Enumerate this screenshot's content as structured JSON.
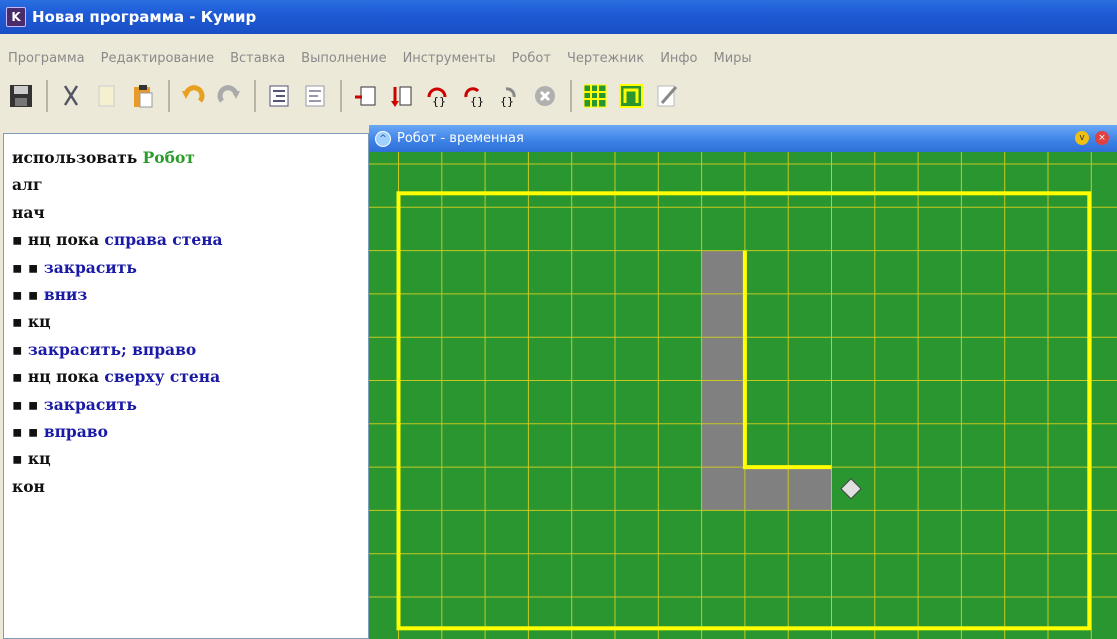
{
  "window": {
    "title": "Новая программа - Кумир",
    "app_icon": "K"
  },
  "menu": [
    "Программа",
    "Редактирование",
    "Вставка",
    "Выполнение",
    "Инструменты",
    "Робот",
    "Чертежник",
    "Инфо",
    "Миры"
  ],
  "toolbar": {
    "icons": [
      "save-icon",
      "cut-icon",
      "copy-icon",
      "paste-icon",
      "undo-icon",
      "redo-icon",
      "indent-icon",
      "unindent-icon",
      "run-icon",
      "step-icon",
      "step-into-icon",
      "step-over-icon",
      "step-out-icon",
      "stop-icon",
      "robot-field-icon",
      "robot-pult-icon",
      "draw-icon"
    ]
  },
  "editor": {
    "lines": [
      [
        {
          "t": "использовать ",
          "c": "plain"
        },
        {
          "t": "Робот",
          "c": "green"
        }
      ],
      [
        {
          "t": "алг",
          "c": "plain"
        }
      ],
      [
        {
          "t": "нач",
          "c": "plain"
        }
      ],
      [
        {
          "t": "▪ нц пока ",
          "c": "plain"
        },
        {
          "t": "справа стена",
          "c": "blue"
        }
      ],
      [
        {
          "t": "▪ ▪ ",
          "c": "plain"
        },
        {
          "t": "закрасить",
          "c": "blue"
        }
      ],
      [
        {
          "t": "▪ ▪ ",
          "c": "plain"
        },
        {
          "t": "вниз",
          "c": "blue"
        }
      ],
      [
        {
          "t": "▪ кц",
          "c": "plain"
        }
      ],
      [
        {
          "t": "▪ ",
          "c": "plain"
        },
        {
          "t": "закрасить; вправо",
          "c": "blue"
        }
      ],
      [
        {
          "t": "▪ нц пока ",
          "c": "plain"
        },
        {
          "t": "сверху стена",
          "c": "blue"
        }
      ],
      [
        {
          "t": "▪ ▪ ",
          "c": "plain"
        },
        {
          "t": "закрасить",
          "c": "blue"
        }
      ],
      [
        {
          "t": "▪ ▪ ",
          "c": "plain"
        },
        {
          "t": "вправо",
          "c": "blue"
        }
      ],
      [
        {
          "t": "▪ кц",
          "c": "plain"
        }
      ],
      [
        {
          "t": "кон",
          "c": "plain"
        }
      ]
    ]
  },
  "robot_window": {
    "title": "Робот - временная",
    "colors": {
      "field": "#2a9630",
      "grid": "#c8c820",
      "wall": "#ffff00",
      "painted": "#808080",
      "robot": "#e0e0e0"
    },
    "painted_cells": [
      [
        7,
        2
      ],
      [
        7,
        3
      ],
      [
        7,
        4
      ],
      [
        7,
        5
      ],
      [
        7,
        6
      ],
      [
        7,
        7
      ],
      [
        8,
        7
      ],
      [
        9,
        7
      ]
    ],
    "robot_cell": [
      10,
      7
    ]
  }
}
